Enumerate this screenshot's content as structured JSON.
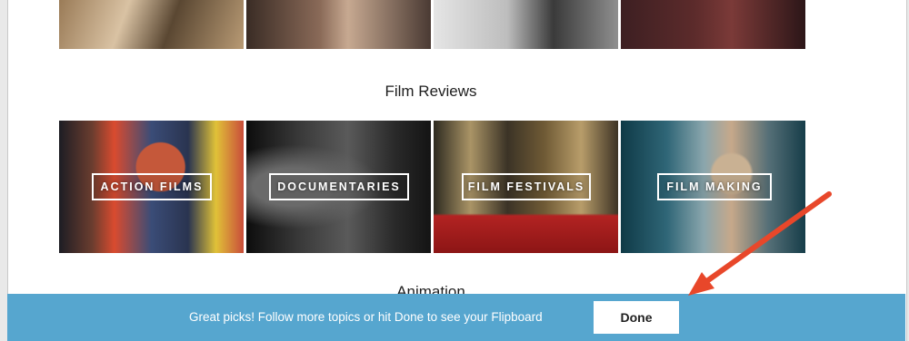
{
  "sections": {
    "film_reviews_title": "Film Reviews",
    "next_section_title": "Animation"
  },
  "top_row": {
    "tiles": [
      "",
      "",
      "",
      ""
    ]
  },
  "film_reviews": {
    "tiles": [
      {
        "label": "ACTION FILMS",
        "image": "action-films-image"
      },
      {
        "label": "DOCUMENTARIES",
        "image": "documentaries-image"
      },
      {
        "label": "FILM FESTIVALS",
        "image": "film-festivals-image"
      },
      {
        "label": "FILM MAKING",
        "image": "film-making-image"
      }
    ]
  },
  "banner": {
    "message": "Great picks! Follow more topics or hit Done to see your Flipboard",
    "done_label": "Done",
    "color": "#56a6cf"
  },
  "annotation": {
    "arrow_color": "#e8472a"
  }
}
